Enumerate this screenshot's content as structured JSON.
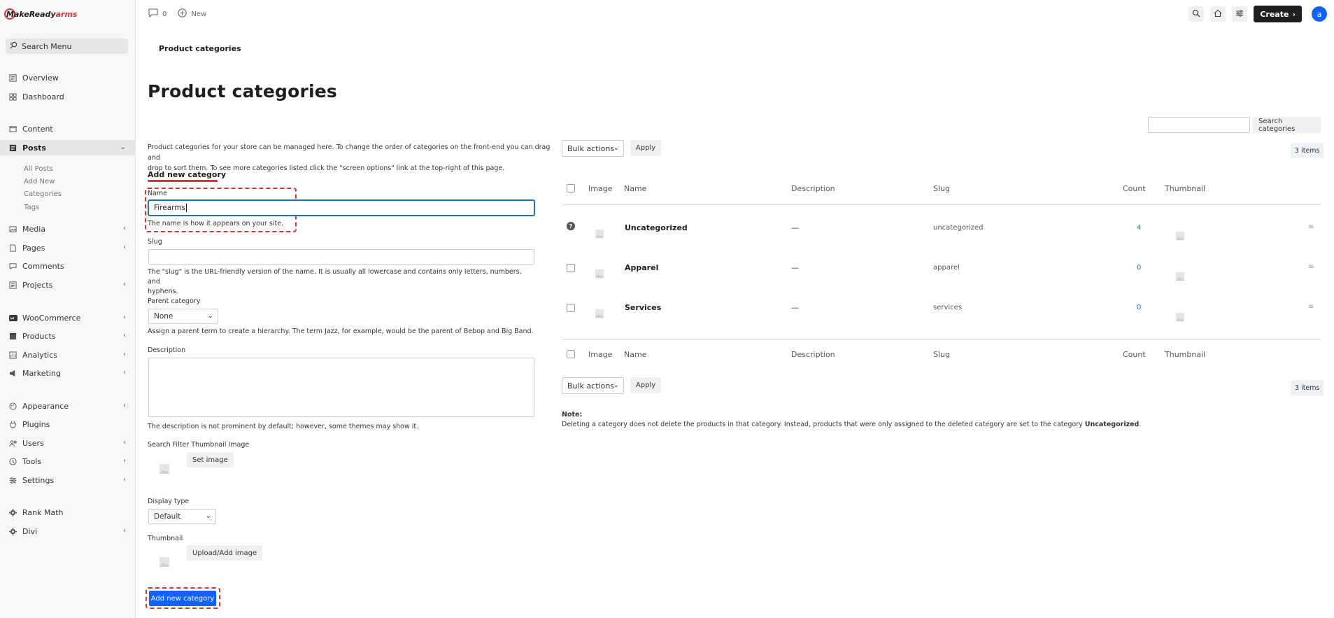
{
  "brand": {
    "name_part1": "MakeReady",
    "name_part2": "arms",
    "accent": "#d63638"
  },
  "sidebar": {
    "search_label": "Search Menu",
    "items": [
      {
        "label": "Overview",
        "icon": "overview-icon"
      },
      {
        "label": "Dashboard",
        "icon": "dashboard-icon"
      },
      {
        "label": "Content",
        "icon": "content-icon"
      },
      {
        "label": "Posts",
        "icon": "posts-icon"
      },
      {
        "label": "Media",
        "icon": "media-icon"
      },
      {
        "label": "Pages",
        "icon": "pages-icon"
      },
      {
        "label": "Comments",
        "icon": "comments-icon"
      },
      {
        "label": "Projects",
        "icon": "projects-icon"
      },
      {
        "label": "WooCommerce",
        "icon": "woocommerce-icon"
      },
      {
        "label": "Products",
        "icon": "products-icon"
      },
      {
        "label": "Analytics",
        "icon": "analytics-icon"
      },
      {
        "label": "Marketing",
        "icon": "marketing-icon"
      },
      {
        "label": "Appearance",
        "icon": "appearance-icon"
      },
      {
        "label": "Plugins",
        "icon": "plugins-icon"
      },
      {
        "label": "Users",
        "icon": "users-icon"
      },
      {
        "label": "Tools",
        "icon": "tools-icon"
      },
      {
        "label": "Settings",
        "icon": "settings-icon"
      },
      {
        "label": "Rank Math",
        "icon": "rank-math-icon"
      },
      {
        "label": "Divi",
        "icon": "divi-icon"
      }
    ],
    "posts_sub": [
      "All Posts",
      "Add New",
      "Categories",
      "Tags"
    ]
  },
  "topbar": {
    "comments_count": "0",
    "new_label": "New",
    "create_label": "Create",
    "avatar_letter": "a"
  },
  "breadcrumb": "Product categories",
  "page_title": "Product categories",
  "intro_line1": "Product categories for your store can be managed here. To change the order of categories on the front-end you can drag and",
  "intro_line2": "drop to sort them. To see more categories listed click the \"screen options\" link at the top-right of this page.",
  "form": {
    "section_title": "Add new category",
    "name_label": "Name",
    "name_value": "Firearms",
    "name_help": "The name is how it appears on your site.",
    "slug_label": "Slug",
    "slug_value": "",
    "slug_help_1": "The \"slug\" is the URL-friendly version of the name. It is usually all lowercase and contains only letters, numbers, and",
    "slug_help_2": "hyphens.",
    "parent_label": "Parent category",
    "parent_value": "None",
    "parent_help": "Assign a parent term to create a hierarchy. The term Jazz, for example, would be the parent of Bebop and Big Band.",
    "description_label": "Description",
    "description_help": "The description is not prominent by default; however, some themes may show it.",
    "filter_thumb_label": "Search Filter Thumbnail Image",
    "set_image_label": "Set image",
    "display_type_label": "Display type",
    "display_type_value": "Default",
    "thumbnail_label": "Thumbnail",
    "upload_label": "Upload/Add image",
    "submit_label": "Add new category"
  },
  "list": {
    "search_button": "Search categories",
    "bulk_actions": "Bulk actions",
    "apply": "Apply",
    "items_count": "3 items",
    "columns": {
      "image": "Image",
      "name": "Name",
      "description": "Description",
      "slug": "Slug",
      "count": "Count",
      "thumbnail": "Thumbnail"
    },
    "rows": [
      {
        "name": "Uncategorized",
        "description": "—",
        "slug": "uncategorized",
        "count": "4"
      },
      {
        "name": "Apparel",
        "description": "—",
        "slug": "apparel",
        "count": "0"
      },
      {
        "name": "Services",
        "description": "—",
        "slug": "services",
        "count": "0"
      }
    ],
    "note_title": "Note:",
    "note_text": "Deleting a category does not delete the products in that category. Instead, products that were only assigned to the deleted category are set to the category ",
    "note_bold": "Uncategorized",
    "note_end": "."
  }
}
